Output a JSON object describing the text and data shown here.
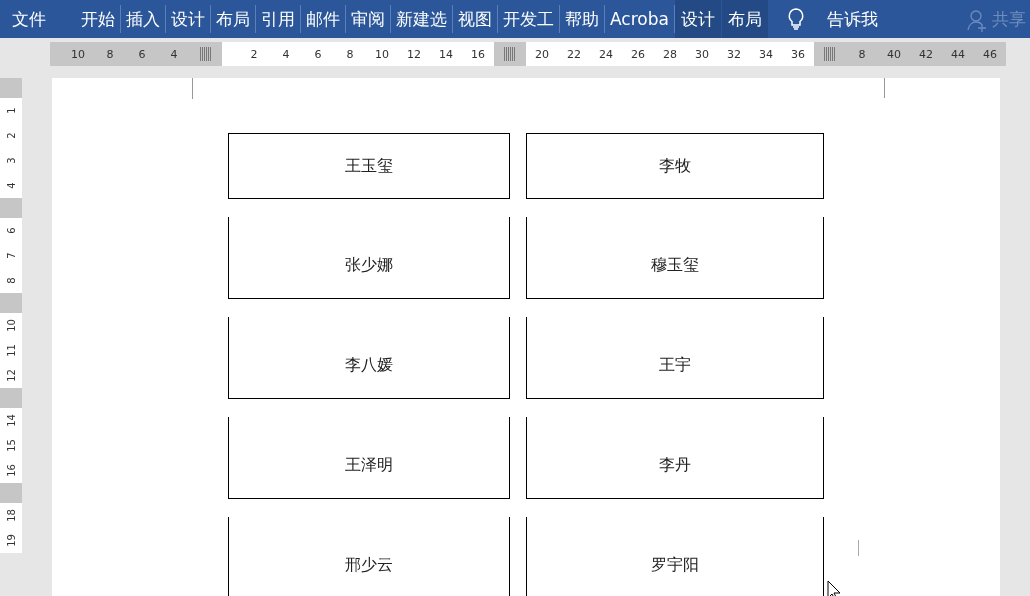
{
  "ribbon": {
    "tabs": [
      {
        "label": "文件",
        "kind": "file"
      },
      {
        "label": "开始",
        "kind": "tab"
      },
      {
        "label": "插入",
        "kind": "tab"
      },
      {
        "label": "设计",
        "kind": "tab"
      },
      {
        "label": "布局",
        "kind": "tab"
      },
      {
        "label": "引用",
        "kind": "tab"
      },
      {
        "label": "邮件",
        "kind": "tab"
      },
      {
        "label": "审阅",
        "kind": "tab"
      },
      {
        "label": "新建选",
        "kind": "tab"
      },
      {
        "label": "视图",
        "kind": "tab"
      },
      {
        "label": "开发工",
        "kind": "tab"
      },
      {
        "label": "帮助",
        "kind": "tab"
      },
      {
        "label": "Acroba",
        "kind": "tab"
      },
      {
        "label": "设计",
        "kind": "context"
      },
      {
        "label": "布局",
        "kind": "context"
      }
    ],
    "tell_me": "告诉我",
    "share": {
      "label": "共享",
      "disabled": true
    }
  },
  "h_ruler": [
    {
      "kind": "margin",
      "items": [
        {
          "kind": "number",
          "label": "10"
        },
        {
          "kind": "number",
          "label": "8"
        },
        {
          "kind": "number",
          "label": "6"
        },
        {
          "kind": "number",
          "label": "4"
        },
        {
          "kind": "marker"
        }
      ]
    },
    {
      "kind": "text",
      "items": [
        {
          "kind": "number",
          "label": "2"
        },
        {
          "kind": "number",
          "label": "4"
        },
        {
          "kind": "number",
          "label": "6"
        },
        {
          "kind": "number",
          "label": "8"
        },
        {
          "kind": "number",
          "label": "10"
        },
        {
          "kind": "number",
          "label": "12"
        },
        {
          "kind": "number",
          "label": "14"
        },
        {
          "kind": "number",
          "label": "16"
        }
      ]
    },
    {
      "kind": "margin",
      "items": [
        {
          "kind": "marker"
        }
      ]
    },
    {
      "kind": "text",
      "items": [
        {
          "kind": "number",
          "label": "20"
        },
        {
          "kind": "number",
          "label": "22"
        },
        {
          "kind": "number",
          "label": "24"
        },
        {
          "kind": "number",
          "label": "26"
        },
        {
          "kind": "number",
          "label": "28"
        },
        {
          "kind": "number",
          "label": "30"
        },
        {
          "kind": "number",
          "label": "32"
        },
        {
          "kind": "number",
          "label": "34"
        },
        {
          "kind": "number",
          "label": "36"
        }
      ]
    },
    {
      "kind": "margin",
      "items": [
        {
          "kind": "marker"
        },
        {
          "kind": "number",
          "label": "8"
        },
        {
          "kind": "number",
          "label": "40"
        },
        {
          "kind": "number",
          "label": "42"
        },
        {
          "kind": "number",
          "label": "44"
        },
        {
          "kind": "number",
          "label": "46"
        }
      ]
    }
  ],
  "v_ruler": [
    {
      "kind": "margin"
    },
    {
      "kind": "number",
      "label": "1"
    },
    {
      "kind": "number",
      "label": "2"
    },
    {
      "kind": "number",
      "label": "3"
    },
    {
      "kind": "number",
      "label": "4"
    },
    {
      "kind": "margin"
    },
    {
      "kind": "number",
      "label": "6"
    },
    {
      "kind": "number",
      "label": "7"
    },
    {
      "kind": "number",
      "label": "8"
    },
    {
      "kind": "margin"
    },
    {
      "kind": "number",
      "label": "10"
    },
    {
      "kind": "number",
      "label": "11"
    },
    {
      "kind": "number",
      "label": "12"
    },
    {
      "kind": "margin"
    },
    {
      "kind": "number",
      "label": "14"
    },
    {
      "kind": "number",
      "label": "15"
    },
    {
      "kind": "number",
      "label": "16"
    },
    {
      "kind": "margin"
    },
    {
      "kind": "number",
      "label": "18"
    },
    {
      "kind": "number",
      "label": "19"
    }
  ],
  "labels": [
    {
      "top_border": true,
      "names": [
        "王玉玺",
        "李牧"
      ]
    },
    {
      "top_border": false,
      "names": [
        "张少娜",
        "穆玉玺"
      ]
    },
    {
      "top_border": false,
      "names": [
        "李八媛",
        "王宇"
      ]
    },
    {
      "top_border": false,
      "names": [
        "王泽明",
        "李丹"
      ]
    },
    {
      "top_border": false,
      "names": [
        "邢少云",
        "罗宇阳"
      ]
    }
  ]
}
